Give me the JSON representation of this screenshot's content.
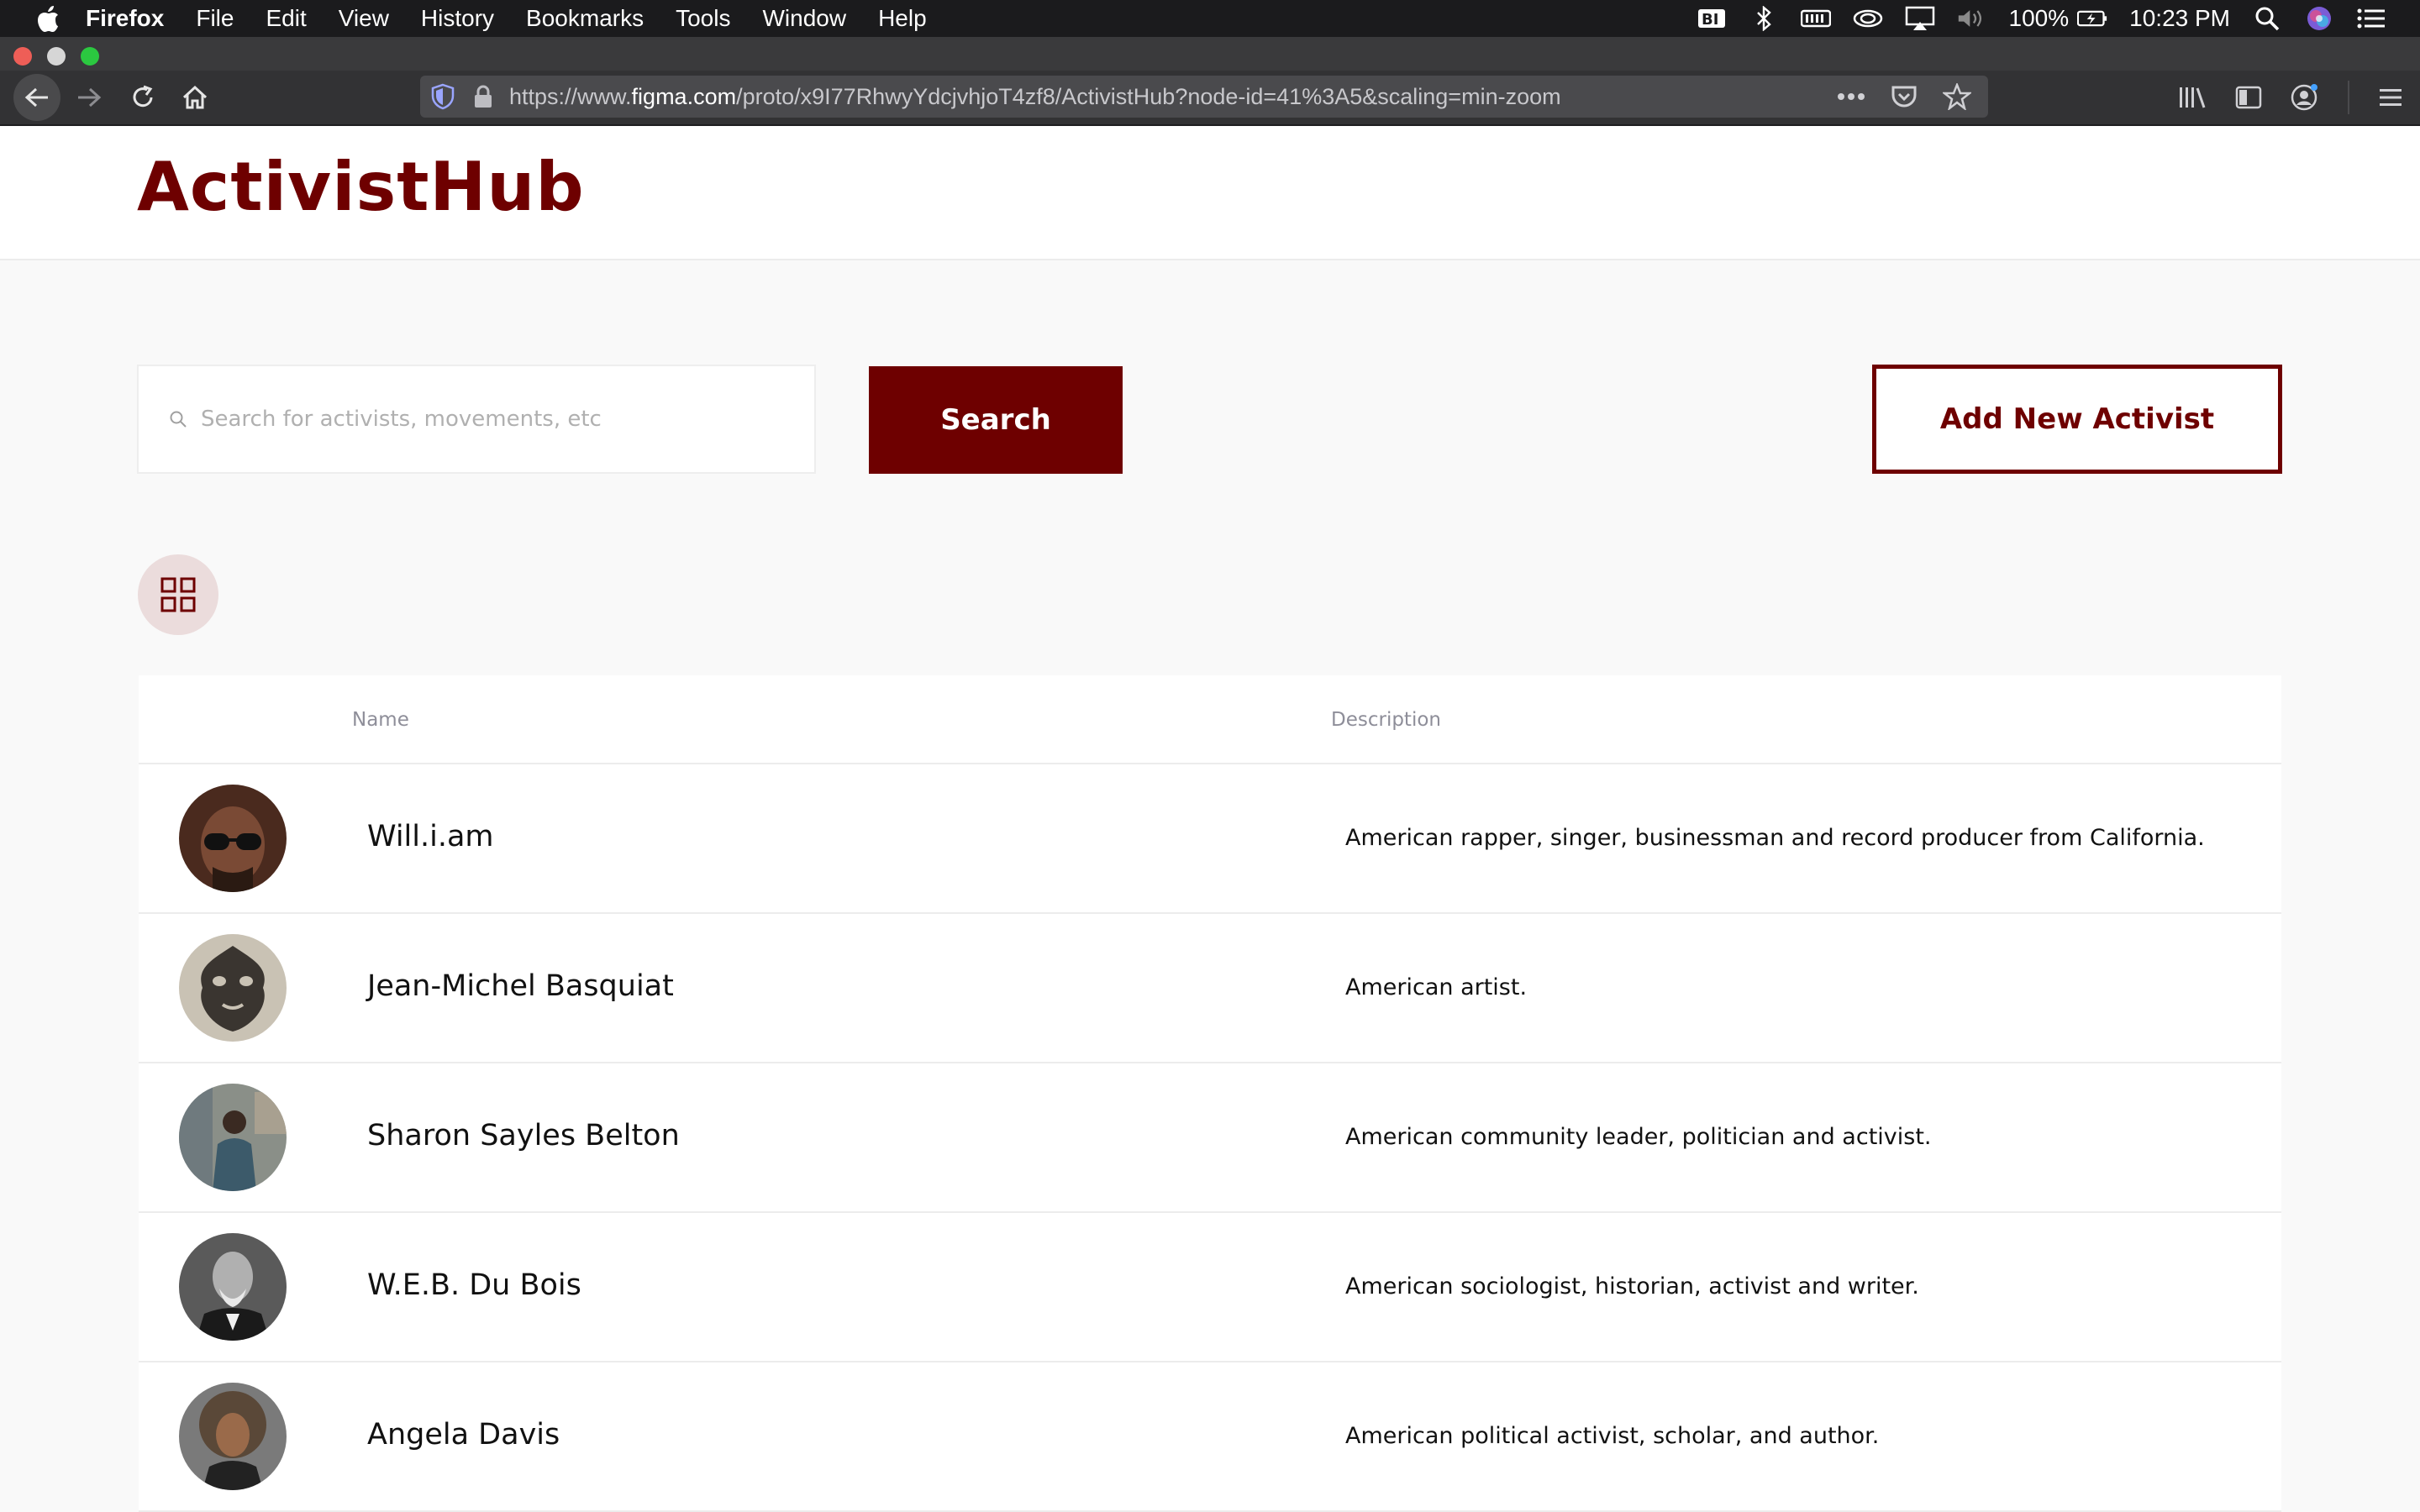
{
  "menubar": {
    "app_name": "Firefox",
    "menus": [
      "File",
      "Edit",
      "View",
      "History",
      "Bookmarks",
      "Tools",
      "Window",
      "Help"
    ],
    "battery": "100%",
    "clock": "10:23 PM"
  },
  "browser": {
    "url_prefix": "https://www.",
    "url_host": "figma.com",
    "url_path": "/proto/x9I77RhwyYdcjvhjoT4zf8/ActivistHub?node-id=41%3A5&scaling=min-zoom"
  },
  "header": {
    "logo": "ActivistHub"
  },
  "search": {
    "placeholder": "Search for activists, movements, etc",
    "button_label": "Search"
  },
  "add_button_label": "Add New Activist",
  "table": {
    "columns": {
      "name": "Name",
      "description": "Description"
    },
    "rows": [
      {
        "name": "Will.i.am",
        "description": "American rapper, singer, businessman and record producer from California.",
        "avatar_color": "#4a2a1e"
      },
      {
        "name": "Jean-Michel Basquiat",
        "description": "American artist.",
        "avatar_color": "#6b655c"
      },
      {
        "name": "Sharon Sayles Belton",
        "description": "American community leader, politician and activist.",
        "avatar_color": "#5d6a70"
      },
      {
        "name": "W.E.B. Du Bois",
        "description": "American sociologist, historian, activist and writer.",
        "avatar_color": "#4a4a4a"
      },
      {
        "name": "Angela Davis",
        "description": "American political activist, scholar, and author.",
        "avatar_color": "#5a4838"
      }
    ]
  },
  "colors": {
    "brand": "#6e0000",
    "grid_toggle_bg": "#ebdcdc"
  }
}
